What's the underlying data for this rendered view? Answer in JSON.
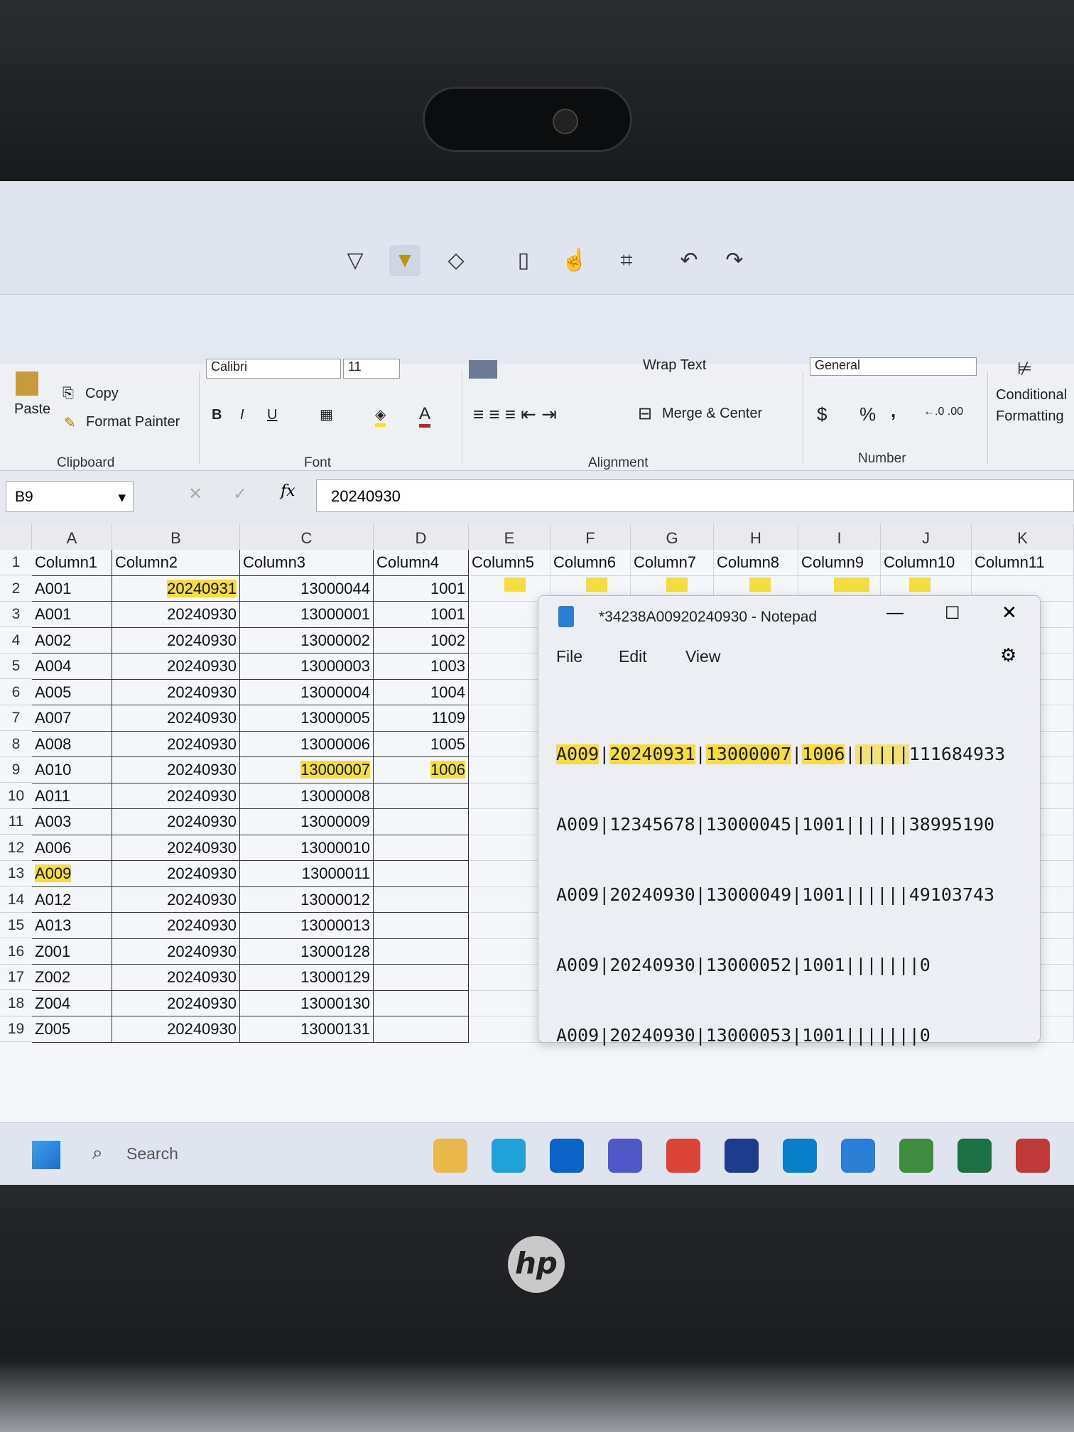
{
  "markup_toolbar": {
    "icons": [
      "pen-icon",
      "highlighter-icon",
      "eraser-icon",
      "ruler-icon",
      "touch-writing-icon",
      "crop-icon",
      "undo-icon",
      "redo-icon"
    ]
  },
  "ribbon": {
    "clipboard": {
      "paste": "Paste",
      "copy": "Copy",
      "format_painter": "Format Painter",
      "label": "Clipboard"
    },
    "font": {
      "name": "Calibri",
      "size": "11",
      "bold": "B",
      "italic": "I",
      "underline": "U",
      "label": "Font",
      "font_color": "A"
    },
    "alignment": {
      "wrap_text": "Wrap Text",
      "merge_center": "Merge & Center",
      "label": "Alignment"
    },
    "number": {
      "format": "General",
      "currency": "$",
      "percent": "%",
      "comma": ",",
      "label": "Number"
    },
    "styles": {
      "conditional_formatting": "Conditional Formatting"
    }
  },
  "formula_bar": {
    "name_box": "B9",
    "fx": "fx",
    "value": "20240930"
  },
  "sheet": {
    "columns": [
      "A",
      "B",
      "C",
      "D",
      "E",
      "F",
      "G",
      "H",
      "I",
      "J",
      "K"
    ],
    "headers": [
      "Column1",
      "Column2",
      "Column3",
      "Column4",
      "Column5",
      "Column6",
      "Column7",
      "Column8",
      "Column9",
      "Column10",
      "Column11"
    ],
    "rows": [
      [
        "A001",
        "20240931",
        "13000044",
        "1001"
      ],
      [
        "A001",
        "20240930",
        "13000001",
        "1001"
      ],
      [
        "A002",
        "20240930",
        "13000002",
        "1002"
      ],
      [
        "A004",
        "20240930",
        "13000003",
        "1003"
      ],
      [
        "A005",
        "20240930",
        "13000004",
        "1004"
      ],
      [
        "A007",
        "20240930",
        "13000005",
        "1109"
      ],
      [
        "A008",
        "20240930",
        "13000006",
        "1005"
      ],
      [
        "A010",
        "20240930",
        "13000007",
        "1006"
      ],
      [
        "A011",
        "20240930",
        "13000008",
        ""
      ],
      [
        "A003",
        "20240930",
        "13000009",
        ""
      ],
      [
        "A006",
        "20240930",
        "13000010",
        ""
      ],
      [
        "A009",
        "20240930",
        "13000011",
        ""
      ],
      [
        "A012",
        "20240930",
        "13000012",
        ""
      ],
      [
        "A013",
        "20240930",
        "13000013",
        ""
      ],
      [
        "Z001",
        "20240930",
        "13000128",
        ""
      ],
      [
        "Z002",
        "20240930",
        "13000129",
        ""
      ],
      [
        "Z004",
        "20240930",
        "13000130",
        ""
      ],
      [
        "Z005",
        "20240930",
        "13000131",
        ""
      ]
    ],
    "highlight_color": "#f4dd3c"
  },
  "notepad": {
    "title": "*34238A00920240930 - Notepad",
    "menu": [
      "File",
      "Edit",
      "View"
    ],
    "lines": [
      "A009|20240931|13000007|1006||||||111684933",
      "A009|12345678|13000045|1001||||||38995190",
      "A009|20240930|13000049|1001||||||49103743",
      "A009|20240930|13000052|1001|||||||0",
      "A009|20240930|13000053|1001|||||||0"
    ]
  },
  "taskbar": {
    "search": "Search",
    "apps": [
      "file-explorer",
      "edge",
      "outlook",
      "teams",
      "chrome",
      "webex",
      "sharepoint",
      "notepad",
      "photos",
      "excel",
      "snipping-tool"
    ]
  },
  "laptop": {
    "brand": "hp"
  }
}
